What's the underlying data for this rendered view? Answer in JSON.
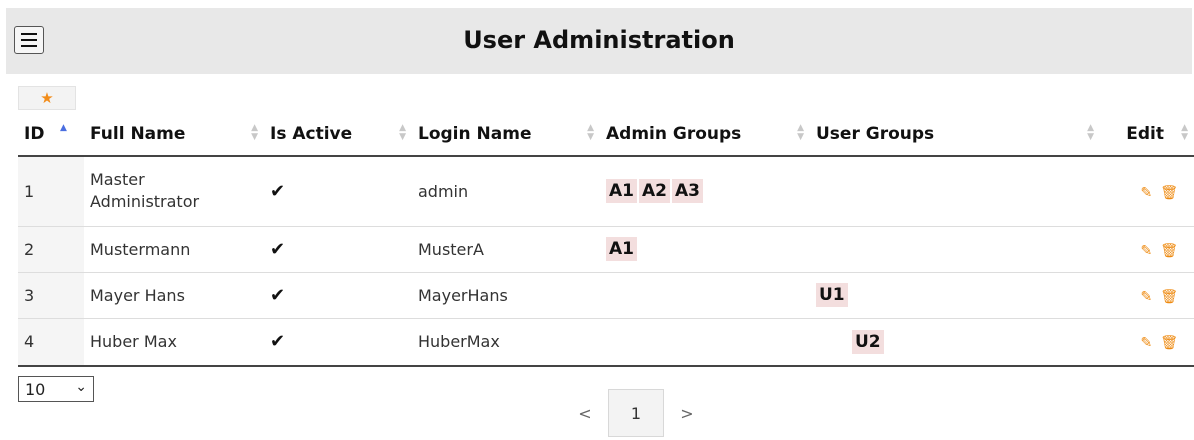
{
  "header": {
    "title": "User Administration",
    "menu_icon": "hamburger-menu-icon"
  },
  "favorites": {
    "icon": "star-icon",
    "glyph": "★",
    "color": "#f28c1a"
  },
  "table": {
    "columns": [
      {
        "label": "ID"
      },
      {
        "label": "Full Name"
      },
      {
        "label": "Is Active"
      },
      {
        "label": "Login Name"
      },
      {
        "label": "Admin Groups"
      },
      {
        "label": "User Groups"
      },
      {
        "label": "Edit"
      }
    ],
    "sorted_column": "ID",
    "sort_direction": "ascending",
    "rows": [
      {
        "id": "1",
        "full_name": "Master Administrator",
        "is_active": "✔",
        "login_name": "admin",
        "admin_groups": [
          "A1",
          "A2",
          "A3"
        ],
        "user_groups": []
      },
      {
        "id": "2",
        "full_name": "Mustermann",
        "is_active": "✔",
        "login_name": "MusterA",
        "admin_groups": [
          "A1"
        ],
        "user_groups": []
      },
      {
        "id": "3",
        "full_name": "Mayer Hans",
        "is_active": "✔",
        "login_name": "MayerHans",
        "admin_groups": [],
        "user_groups": [
          "U1"
        ]
      },
      {
        "id": "4",
        "full_name": "Huber Max",
        "is_active": "✔",
        "login_name": "HuberMax",
        "admin_groups": [],
        "user_groups": [
          "U2"
        ]
      }
    ],
    "row_actions": {
      "edit_icon": "pencil-icon",
      "edit_glyph": "✎",
      "delete_icon": "trash-icon",
      "delete_glyph": "🗑"
    }
  },
  "pagination": {
    "page_size": "10",
    "prev": "<",
    "current_page": "1",
    "next": ">"
  },
  "colors": {
    "accent": "#ee8a10",
    "group_badge": "#f3dede",
    "header_bg": "#e8e8e8",
    "sort_active": "#4a6ee0"
  }
}
